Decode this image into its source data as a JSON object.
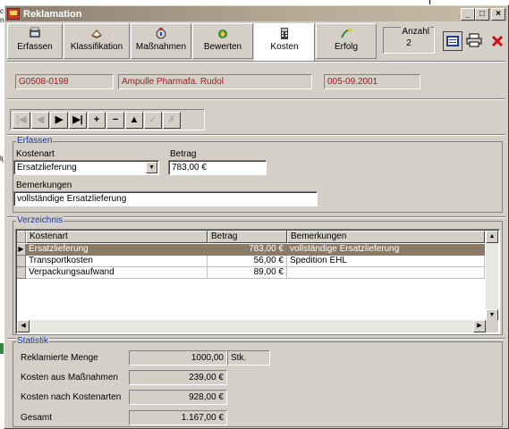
{
  "background": {
    "stub_top": "c",
    "stub_mid": "n",
    "stub_lower": "lg"
  },
  "window": {
    "title": "Reklamation",
    "controls": {
      "minimize": "_",
      "maximize": "□",
      "close": "×"
    }
  },
  "tabs": [
    {
      "label": "Erfassen",
      "icon": "scanner-icon"
    },
    {
      "label": "Klassifikation",
      "icon": "clipboard-icon"
    },
    {
      "label": "Maßnahmen",
      "icon": "measures-icon"
    },
    {
      "label": "Bewerten",
      "icon": "rating-icon"
    },
    {
      "label": "Kosten",
      "icon": "calculator-icon",
      "active": true
    },
    {
      "label": "Erfolg",
      "icon": "success-icon"
    }
  ],
  "anzahl": {
    "label": "Anzahl",
    "value": "2"
  },
  "toolbar_icons": {
    "print_preview": "preview-icon",
    "print": "printer-icon",
    "delete": "delete-x-icon"
  },
  "header": {
    "number": "G0508-0198",
    "product": "Ampulle Pharmafa. Rudol",
    "date": "005-09.2001"
  },
  "nav": {
    "first": "|◀",
    "prev": "◀",
    "next": "▶",
    "last": "▶|",
    "add": "+",
    "remove": "−",
    "edit": "▲",
    "save": "✓",
    "cancel": "✗"
  },
  "erfassen": {
    "title": "Erfassen",
    "kostenart_label": "Kostenart",
    "kostenart_value": "Ersatzlieferung",
    "betrag_label": "Betrag",
    "betrag_value": "783,00 €",
    "bemerkungen_label": "Bemerkungen",
    "bemerkungen_value": "vollständige Ersatzlieferung"
  },
  "verzeichnis": {
    "title": "Verzeichnis",
    "columns": [
      "Kostenart",
      "Betrag",
      "Bemerkungen"
    ],
    "rows": [
      {
        "kostenart": "Ersatzlieferung",
        "betrag": "783,00 €",
        "bemerkungen": "vollständige Ersatzlieferung",
        "selected": true
      },
      {
        "kostenart": "Transportkosten",
        "betrag": "56,00 €",
        "bemerkungen": "Spedition EHL"
      },
      {
        "kostenart": "Verpackungsaufwand",
        "betrag": "89,00 €",
        "bemerkungen": ""
      }
    ]
  },
  "statistik": {
    "title": "Statistik",
    "rows": [
      {
        "label": "Reklamierte Menge",
        "value": "1000,00",
        "unit": "Stk."
      },
      {
        "label": "Kosten aus Maßnahmen",
        "value": "239,00 €"
      },
      {
        "label": "Kosten nach Kostenarten",
        "value": "928,00 €"
      },
      {
        "label": "Gesamt",
        "value": "1.167,00 €"
      }
    ]
  },
  "colors": {
    "title_bar": "#8a7f6e",
    "selection": "#8c7b64",
    "group_title": "#1e3c9a",
    "header_text": "#a51a1a"
  }
}
